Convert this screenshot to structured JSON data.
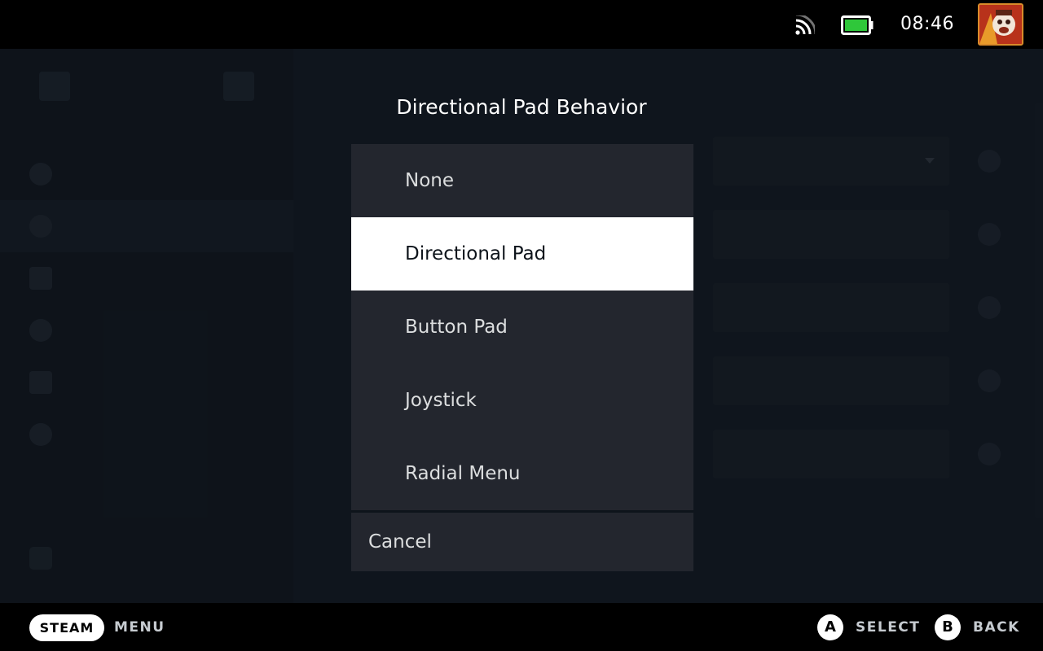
{
  "status_bar": {
    "clock": "08:46",
    "wifi_icon": "wifi-icon",
    "battery_icon": "battery-icon",
    "battery_color": "#2fc73a",
    "avatar_icon": "user-avatar"
  },
  "dialog": {
    "title": "Directional Pad Behavior",
    "options": [
      {
        "label": "None",
        "selected": false
      },
      {
        "label": "Directional Pad",
        "selected": true
      },
      {
        "label": "Button Pad",
        "selected": false
      },
      {
        "label": "Joystick",
        "selected": false
      },
      {
        "label": "Radial Menu",
        "selected": false
      }
    ],
    "cancel_label": "Cancel"
  },
  "bottom_bar": {
    "steam_label": "STEAM",
    "menu_label": "MENU",
    "a_glyph": "A",
    "select_label": "SELECT",
    "b_glyph": "B",
    "back_label": "BACK"
  },
  "colors": {
    "background": "#0e141b",
    "dialog_surface": "#23262e",
    "selected_option": "#ffffff",
    "bar": "#000000"
  }
}
